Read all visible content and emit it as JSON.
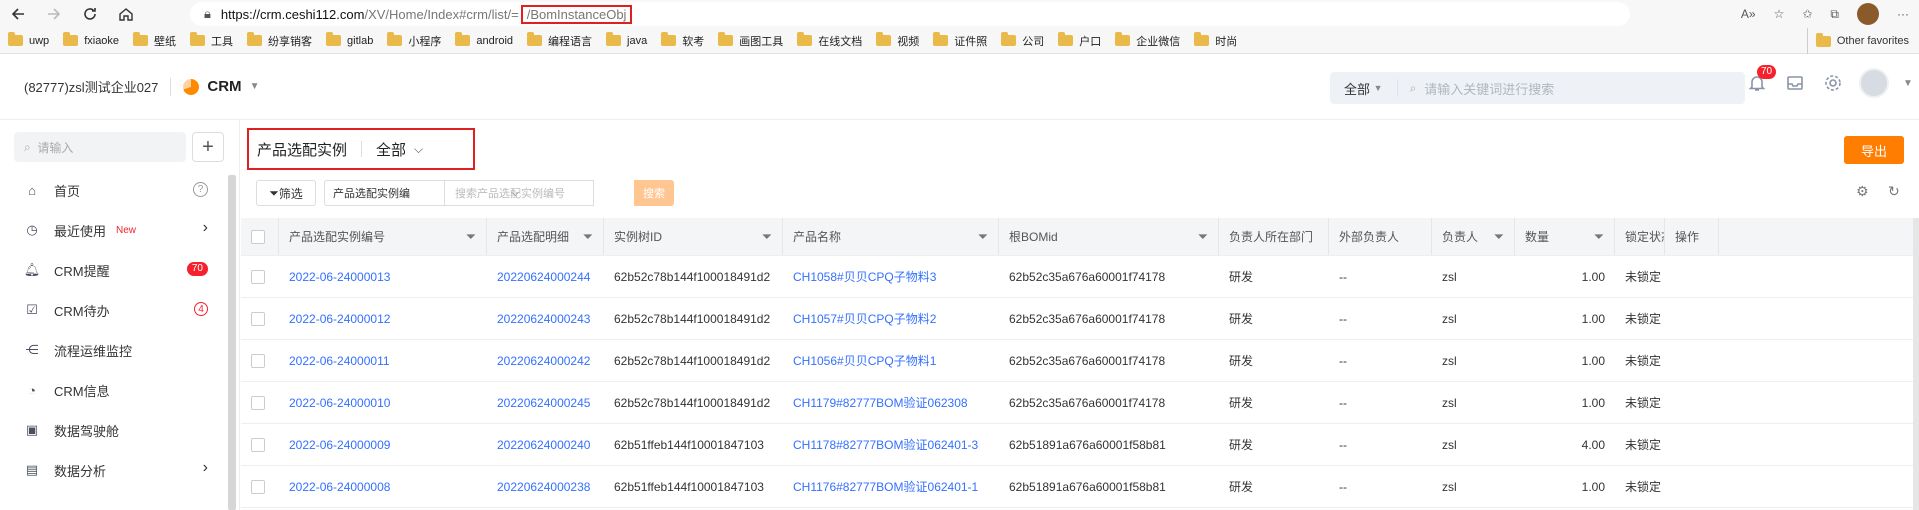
{
  "browser": {
    "url_domain": "https://crm.ceshi112.com",
    "url_path": "/XV/Home/Index#crm/list/=",
    "url_highlight": "/BomInstanceObj",
    "bookmarks": [
      "uwp",
      "fxiaoke",
      "壁纸",
      "工具",
      "纷享销客",
      "gitlab",
      "小程序",
      "android",
      "编程语言",
      "java",
      "软考",
      "画图工具",
      "在线文档",
      "视频",
      "证件照",
      "公司",
      "户口",
      "企业微信",
      "时尚"
    ],
    "other_favorites": "Other favorites"
  },
  "header": {
    "org": "(82777)zsl测试企业027",
    "app": "CRM",
    "scope": "全部",
    "search_placeholder": "请输入关键词进行搜索",
    "notif_count": "70"
  },
  "sidebar": {
    "search_placeholder": "请输入",
    "items": [
      {
        "label": "首页",
        "icon": "home-icon",
        "extra": "?"
      },
      {
        "label": "最近使用",
        "icon": "clock-icon",
        "tag": "New",
        "extra": "›"
      },
      {
        "label": "CRM提醒",
        "icon": "bell-icon",
        "count": "70"
      },
      {
        "label": "CRM待办",
        "icon": "todo-icon",
        "count": "4"
      },
      {
        "label": "流程运维监控",
        "icon": "flow-icon"
      },
      {
        "label": "CRM信息",
        "icon": "pie-icon"
      },
      {
        "label": "数据驾驶舱",
        "icon": "monitor-icon"
      },
      {
        "label": "数据分析",
        "icon": "folder-icon",
        "extra": "›"
      }
    ]
  },
  "view": {
    "title": "产品选配实例",
    "filter_scope": "全部",
    "export_label": "导出",
    "filter_label": "筛选",
    "field_select": "产品选配实例编",
    "search_placeholder": "搜索产品选配实例编号",
    "search_label": "搜索"
  },
  "table": {
    "columns": [
      "产品选配实例编号",
      "产品选配明细",
      "实例树ID",
      "产品名称",
      "根BOMid",
      "负责人所在部门",
      "外部负责人",
      "负责人",
      "数量",
      "锁定状态",
      "操作"
    ],
    "rows": [
      [
        "2022-06-24000013",
        "20220624000244",
        "62b52c78b144f100018491d2",
        "CH1058#贝贝CPQ子物料3",
        "62b52c35a676a60001f74178",
        "研发",
        "--",
        "zsl",
        "1.00",
        "未锁定"
      ],
      [
        "2022-06-24000012",
        "20220624000243",
        "62b52c78b144f100018491d2",
        "CH1057#贝贝CPQ子物料2",
        "62b52c35a676a60001f74178",
        "研发",
        "--",
        "zsl",
        "1.00",
        "未锁定"
      ],
      [
        "2022-06-24000011",
        "20220624000242",
        "62b52c78b144f100018491d2",
        "CH1056#贝贝CPQ子物料1",
        "62b52c35a676a60001f74178",
        "研发",
        "--",
        "zsl",
        "1.00",
        "未锁定"
      ],
      [
        "2022-06-24000010",
        "20220624000245",
        "62b52c78b144f100018491d2",
        "CH1179#82777BOM验证062308",
        "62b52c35a676a60001f74178",
        "研发",
        "--",
        "zsl",
        "1.00",
        "未锁定"
      ],
      [
        "2022-06-24000009",
        "20220624000240",
        "62b51ffeb144f10001847103",
        "CH1178#82777BOM验证062401-3",
        "62b51891a676a60001f58b81",
        "研发",
        "--",
        "zsl",
        "4.00",
        "未锁定"
      ],
      [
        "2022-06-24000008",
        "20220624000238",
        "62b51ffeb144f10001847103",
        "CH1176#82777BOM验证062401-1",
        "62b51891a676a60001f58b81",
        "研发",
        "--",
        "zsl",
        "1.00",
        "未锁定"
      ]
    ]
  },
  "colors": {
    "accent": "#3370ff",
    "export": "#ff7d00",
    "highlight": "#e02020"
  }
}
